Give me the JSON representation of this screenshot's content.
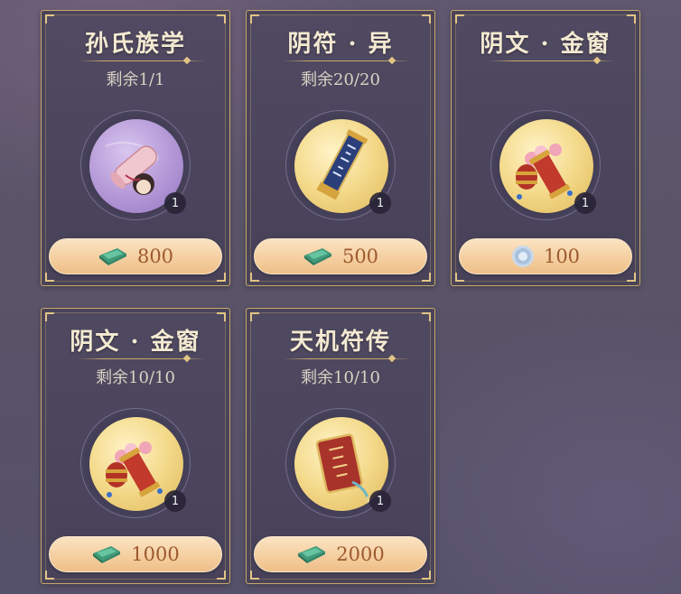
{
  "cards": [
    {
      "title": "孙氏族学",
      "remain": "剩余1/1",
      "qty": "1",
      "price": "800",
      "currency": "jade-currency-icon",
      "item": "scroll-portrait-icon"
    },
    {
      "title": "阴符 · 异",
      "remain": "剩余20/20",
      "qty": "1",
      "price": "500",
      "currency": "jade-currency-icon",
      "item": "talisman-tablet-icon"
    },
    {
      "title": "阴文 · 金窗",
      "remain": "",
      "qty": "1",
      "price": "100",
      "currency": "silver-coin-icon",
      "item": "lantern-gift-icon"
    },
    {
      "title": "阴文 · 金窗",
      "remain": "剩余10/10",
      "qty": "1",
      "price": "1000",
      "currency": "jade-currency-icon",
      "item": "lantern-gift-icon"
    },
    {
      "title": "天机符传",
      "remain": "剩余10/10",
      "qty": "1",
      "price": "2000",
      "currency": "jade-currency-icon",
      "item": "red-amulet-icon"
    }
  ],
  "colors": {
    "frame": "#c8a86a",
    "button": "#f5cfa1",
    "price_text": "#9c5a2e",
    "title_text": "#f4ead2"
  }
}
